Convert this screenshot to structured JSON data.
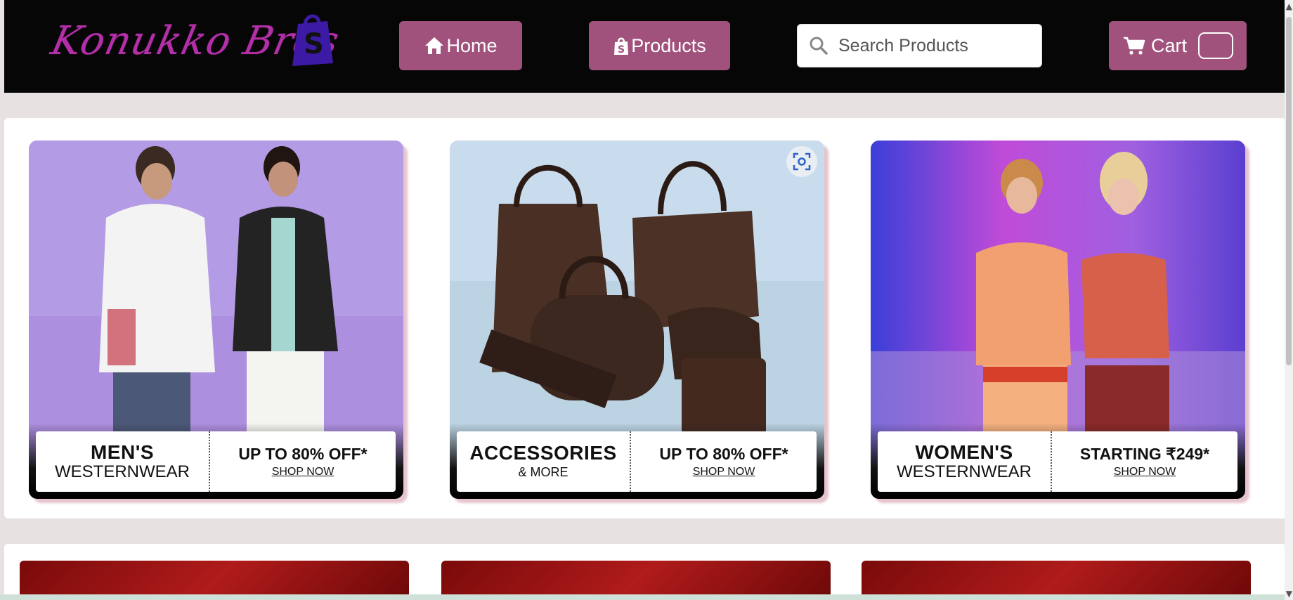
{
  "header": {
    "logo_text": "Konukko Bros",
    "nav": {
      "home_label": "Home",
      "products_label": "Products"
    },
    "search": {
      "placeholder": "Search Products",
      "value": ""
    },
    "cart": {
      "label": "Cart",
      "count": ""
    }
  },
  "banners": [
    {
      "title": "MEN'S",
      "subtitle": "WESTERNWEAR",
      "offer": "UP TO 80% OFF*",
      "cta": "SHOP NOW"
    },
    {
      "title": "ACCESSORIES",
      "subtitle": "& MORE",
      "offer": "UP TO 80% OFF*",
      "cta": "SHOP NOW"
    },
    {
      "title": "WOMEN'S",
      "subtitle": "WESTERNWEAR",
      "offer": "STARTING ₹249*",
      "cta": "SHOP NOW"
    }
  ],
  "colors": {
    "nav_button": "#a0527c",
    "header_bg": "#070606",
    "logo": "#b22fa7",
    "page_bg": "#e7e1e1"
  },
  "icons": [
    "home-icon",
    "shopping-bag-icon",
    "search-icon",
    "cart-icon",
    "visual-search-icon"
  ]
}
